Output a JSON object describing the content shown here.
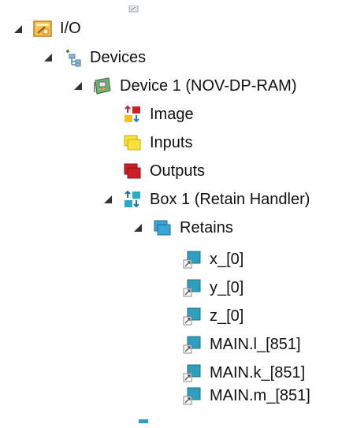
{
  "tree": {
    "io": {
      "label": "I/O",
      "icon": "io-folder-icon"
    },
    "devices": {
      "label": "Devices",
      "icon": "devices-icon"
    },
    "device1": {
      "label": "Device 1 (NOV-DP-RAM)",
      "icon": "device-card-icon"
    },
    "image": {
      "label": "Image",
      "icon": "image-icon"
    },
    "inputs": {
      "label": "Inputs",
      "icon": "inputs-icon"
    },
    "outputs": {
      "label": "Outputs",
      "icon": "outputs-icon"
    },
    "box1": {
      "label": "Box 1 (Retain Handler)",
      "icon": "box-icon"
    },
    "retains": {
      "label": "Retains",
      "icon": "retains-icon"
    },
    "variables": [
      {
        "label": "x_[0]",
        "icon": "variable-link-icon"
      },
      {
        "label": "y_[0]",
        "icon": "variable-link-icon"
      },
      {
        "label": "z_[0]",
        "icon": "variable-link-icon"
      },
      {
        "label": "MAIN.l_[851]",
        "icon": "variable-link-icon"
      },
      {
        "label": "MAIN.k_[851]",
        "icon": "variable-link-icon"
      },
      {
        "label": "MAIN.m_[851]",
        "icon": "variable-link-icon"
      }
    ]
  },
  "colors": {
    "io_orange": "#e8a23a",
    "image_red": "#d11f2a",
    "image_yellow": "#f4c21a",
    "inputs_yellow": "#f6e23a",
    "outputs_red": "#cc1f28",
    "box_teal": "#2aa9c9",
    "var_teal": "#2f9fbf",
    "expander": "#333333"
  }
}
